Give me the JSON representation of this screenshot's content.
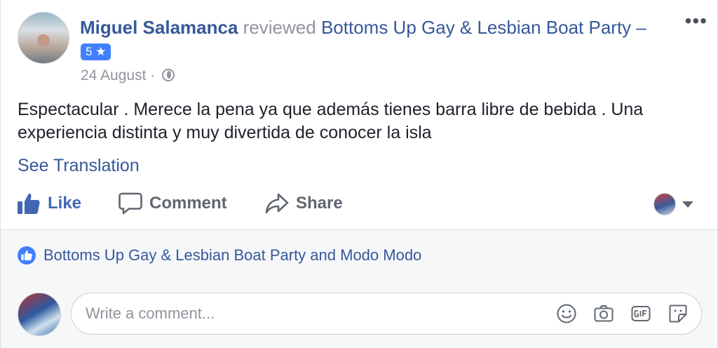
{
  "post": {
    "author": "Miguel Salamanca",
    "verb": "reviewed",
    "page": "Bottoms Up Gay & Lesbian Boat Party –",
    "rating": "5 ★",
    "date": "24 August",
    "separator": "·",
    "more": "•••",
    "text": "Espectacular . Merece la pena ya que además tienes barra libre de bebida . Una experiencia distinta y muy divertida de conocer la isla",
    "see_translation": "See Translation"
  },
  "actions": {
    "like": "Like",
    "comment": "Comment",
    "share": "Share"
  },
  "reactions": {
    "text": "Bottoms Up Gay & Lesbian Boat Party and Modo Modo"
  },
  "composer": {
    "placeholder": "Write a comment..."
  },
  "icons": {
    "more": "more-horizontal-icon",
    "globe": "globe-icon",
    "like": "thumbs-up-icon",
    "comment": "speech-bubble-icon",
    "share": "share-arrow-icon",
    "caret": "caret-down-icon",
    "emoji": "smiley-icon",
    "camera": "camera-icon",
    "gif": "gif-icon",
    "sticker": "sticker-icon"
  },
  "colors": {
    "link": "#365899",
    "like_blue": "#4267b2",
    "badge_blue": "#4080ff",
    "muted": "#90949c",
    "band_bg": "#f6f7f9"
  }
}
